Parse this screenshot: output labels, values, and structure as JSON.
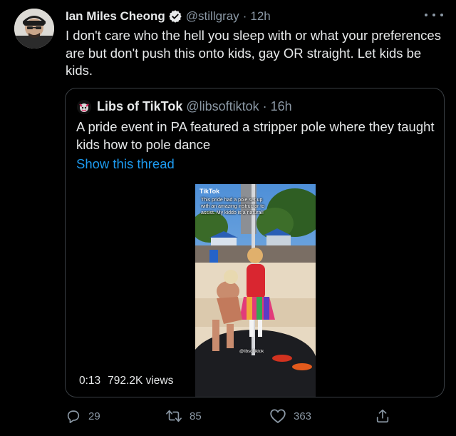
{
  "tweet": {
    "author_name": "Ian Miles Cheong",
    "author_handle": "@stillgray",
    "separator": "·",
    "time": "12h",
    "text": "I don't care who the hell you sleep with or what your preferences are but don't push this onto kids, gay OR straight. Let kids be kids."
  },
  "quoted_tweet": {
    "author_name": "Libs of TikTok",
    "author_handle": "@libsoftiktok",
    "separator": "·",
    "time": "16h",
    "text": "A pride event in PA featured a stripper pole where they taught kids how to pole dance",
    "show_thread_label": "Show this thread",
    "video": {
      "platform_logo": "TikTok",
      "caption": "This pride had a pole set up with an amazing instructor to assist. My kiddo is a natural!",
      "watermark": "@libsoftiktok",
      "duration": "0:13",
      "views": "792.2K views"
    }
  },
  "actions": {
    "reply_count": "29",
    "retweet_count": "85",
    "like_count": "363"
  },
  "icons": {
    "verified": "verified-badge-icon",
    "more": "more-icon",
    "reply": "reply-icon",
    "retweet": "retweet-icon",
    "like": "heart-icon",
    "share": "share-icon"
  },
  "colors": {
    "background": "#000000",
    "text_primary": "#e7e9ea",
    "text_secondary": "#8b98a5",
    "link": "#1d9bf0",
    "border": "#3a3f44"
  }
}
